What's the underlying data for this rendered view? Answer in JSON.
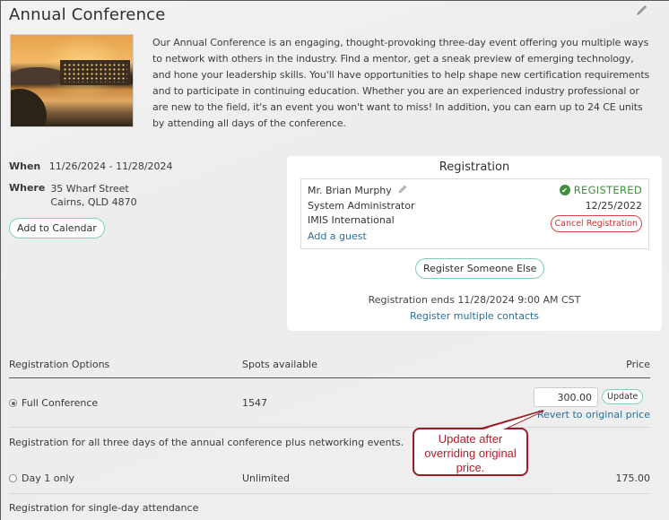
{
  "event": {
    "title": "Annual Conference",
    "description": "Our Annual Conference is an engaging, thought-provoking three-day event offering you multiple ways to network with others in the industry. Find a mentor, get a sneak preview of emerging technology, and hone your leadership skills. You'll have opportunities to help shape new certification requirements and to participate in continuing education. Whether you are an experienced industry professional or are new to the field, it's an event you won't want to miss! In addition, you can earn up to 24 CE units by attending all days of the conference.",
    "when_label": "When",
    "when_value": "11/26/2024 - 11/28/2024",
    "where_label": "Where",
    "where_line1": "35 Wharf Street",
    "where_line2": "Cairns, QLD 4870",
    "add_calendar_label": "Add to Calendar"
  },
  "registration": {
    "title": "Registration",
    "registrant_name": "Mr. Brian Murphy",
    "registrant_role": "System Administrator",
    "registrant_org": "IMIS International",
    "add_guest_label": "Add a guest",
    "status": "REGISTERED",
    "status_date": "12/25/2022",
    "cancel_label": "Cancel Registration",
    "register_else_label": "Register Someone Else",
    "ends_text": "Registration ends 11/28/2024 9:00 AM CST",
    "register_multiple_label": "Register multiple contacts",
    "status_color": "#3e8e3e"
  },
  "options_table": {
    "headers": [
      "Registration Options",
      "Spots available",
      "Price"
    ],
    "rows": [
      {
        "name": "Full Conference",
        "selected": true,
        "spots": "1547",
        "price_input": "300.00",
        "update_label": "Update",
        "revert_label": "Revert to original price",
        "description": "Registration for all three days of the annual conference plus networking events."
      },
      {
        "name": "Day 1 only",
        "selected": false,
        "spots": "Unlimited",
        "price": "175.00",
        "description": "Registration for single-day attendance"
      }
    ]
  },
  "callout": {
    "text": "Update after overriding original price.",
    "color": "#9b1c24"
  }
}
